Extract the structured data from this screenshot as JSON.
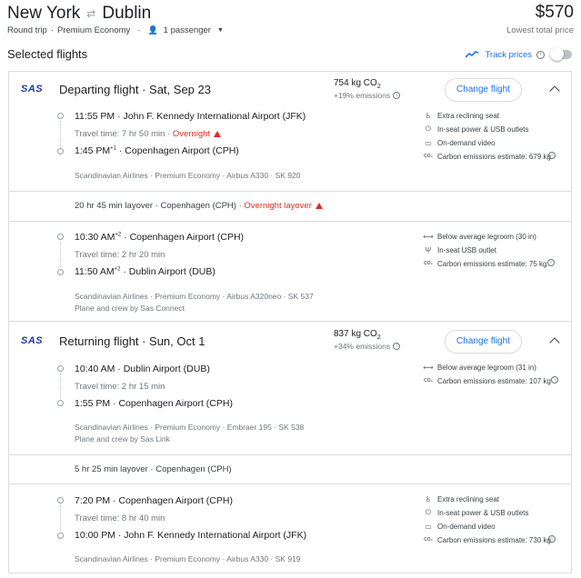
{
  "header": {
    "origin": "New York",
    "destination": "Dublin",
    "price": "$570",
    "trip_type": "Round trip",
    "cabin": "Premium Economy",
    "passengers": "1 passenger",
    "price_note": "Lowest total price"
  },
  "selected": {
    "title": "Selected flights",
    "track_prices": "Track prices"
  },
  "departing": {
    "airline_logo": "SAS",
    "title": "Departing flight",
    "date": "Sat, Sep 23",
    "emissions": "754 kg CO",
    "emissions_sub": "2",
    "emissions_pct": "+19% emissions",
    "button": "Change flight",
    "seg1": {
      "dep_time": "11:55 PM",
      "dep_airport": "John F. Kennedy International Airport (JFK)",
      "overnight": "Overnight",
      "travel_time": "Travel time: 7 hr 50 min",
      "arr_time": "1:45 PM",
      "arr_sup": "+1",
      "arr_airport": "Copenhagen Airport (CPH)",
      "details": "Scandinavian Airlines · Premium Economy · Airbus A330 · SK 920",
      "amenities": [
        "Extra reclining seat",
        "In-seat power & USB outlets",
        "On-demand video",
        "Carbon emissions estimate: 679 kg"
      ]
    },
    "layover": "20 hr 45 min layover · Copenhagen (CPH) · ",
    "layover_warn": "Overnight layover",
    "seg2": {
      "dep_time": "10:30 AM",
      "dep_sup": "+2",
      "dep_airport": "Copenhagen Airport (CPH)",
      "travel_time": "Travel time: 2 hr 20 min",
      "arr_time": "11:50 AM",
      "arr_sup": "+2",
      "arr_airport": "Dublin Airport (DUB)",
      "details": "Scandinavian Airlines · Premium Economy · Airbus A320neo · SK 537",
      "operator": "Plane and crew by Sas Connect",
      "amenities": [
        "Below average legroom (30 in)",
        "In-seat USB outlet",
        "Carbon emissions estimate: 75 kg"
      ]
    }
  },
  "returning": {
    "airline_logo": "SAS",
    "title": "Returning flight",
    "date": "Sun, Oct 1",
    "emissions": "837 kg CO",
    "emissions_sub": "2",
    "emissions_pct": "+34% emissions",
    "button": "Change flight",
    "seg1": {
      "dep_time": "10:40 AM",
      "dep_airport": "Dublin Airport (DUB)",
      "travel_time": "Travel time: 2 hr 15 min",
      "arr_time": "1:55 PM",
      "arr_airport": "Copenhagen Airport (CPH)",
      "details": "Scandinavian Airlines · Premium Economy · Embraer 195 · SK 538",
      "operator": "Plane and crew by Sas Link",
      "amenities": [
        "Below average legroom (31 in)",
        "Carbon emissions estimate: 107 kg"
      ]
    },
    "layover": "5 hr 25 min layover · Copenhagen (CPH)",
    "seg2": {
      "dep_time": "7:20 PM",
      "dep_airport": "Copenhagen Airport (CPH)",
      "travel_time": "Travel time: 8 hr 40 min",
      "arr_time": "10:00 PM",
      "arr_airport": "John F. Kennedy International Airport (JFK)",
      "details": "Scandinavian Airlines · Premium Economy · Airbus A330 · SK 919",
      "amenities": [
        "Extra reclining seat",
        "In-seat power & USB outlets",
        "On-demand video",
        "Carbon emissions estimate: 730 kg"
      ]
    }
  },
  "colors": {
    "accent": "#1a73e8",
    "warning": "#d93025",
    "border": "#dadce0",
    "logo": "#1a3d9c"
  }
}
